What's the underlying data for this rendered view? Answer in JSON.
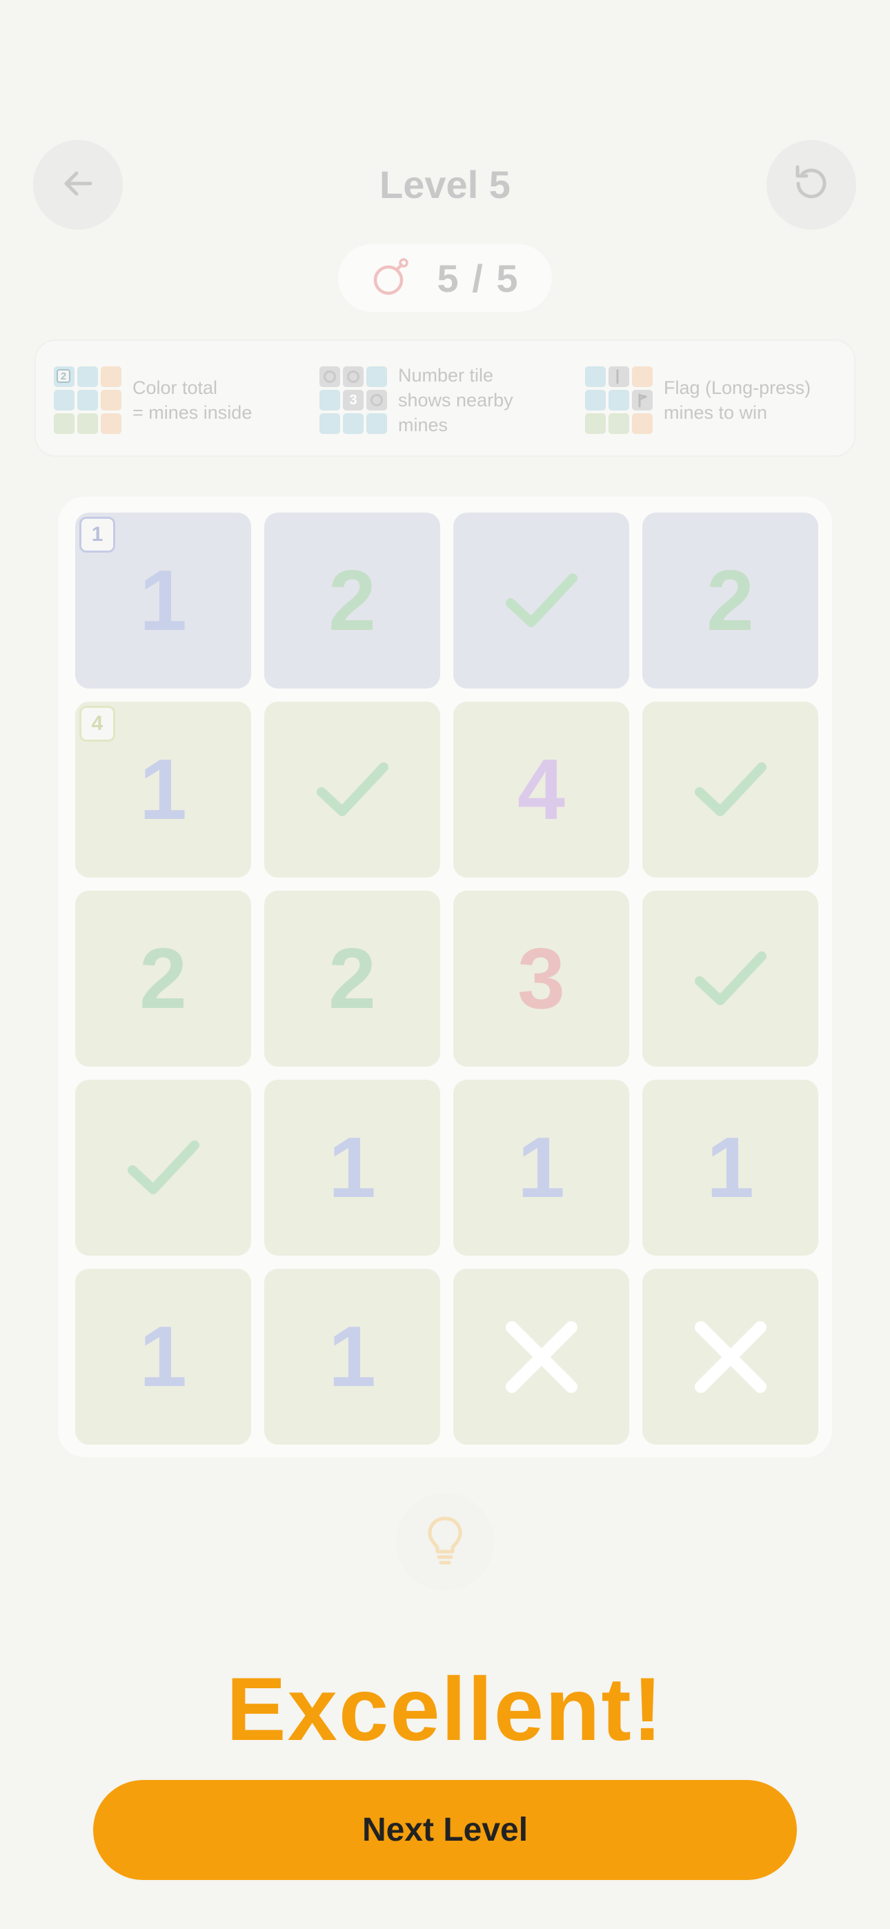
{
  "header": {
    "title": "Level 5",
    "back_icon": "arrow-left-icon",
    "restart_icon": "restart-icon"
  },
  "mines": {
    "icon": "bomb-icon",
    "count": "5 / 5"
  },
  "legend": {
    "items": [
      {
        "text_line1": "Color total",
        "text_line2": "= mines inside",
        "badge_num": "2"
      },
      {
        "text_line1": "Number tile",
        "text_line2": "shows nearby",
        "text_line3": "mines",
        "center_num": "3"
      },
      {
        "text_line1": "Flag (Long-press)",
        "text_line2": "mines to win"
      }
    ]
  },
  "board": {
    "rows": [
      [
        {
          "region": "blue",
          "badge": "1",
          "type": "number",
          "value": "1",
          "color": "blue"
        },
        {
          "region": "blue",
          "type": "number",
          "value": "2",
          "color": "green"
        },
        {
          "region": "blue",
          "type": "check"
        },
        {
          "region": "blue",
          "type": "number",
          "value": "2",
          "color": "green"
        }
      ],
      [
        {
          "region": "green",
          "badge": "4",
          "type": "number",
          "value": "1",
          "color": "blue"
        },
        {
          "region": "green",
          "type": "check"
        },
        {
          "region": "green",
          "type": "number",
          "value": "4",
          "color": "purple"
        },
        {
          "region": "green",
          "type": "check"
        }
      ],
      [
        {
          "region": "green",
          "type": "number",
          "value": "2",
          "color": "green"
        },
        {
          "region": "green",
          "type": "number",
          "value": "2",
          "color": "green"
        },
        {
          "region": "green",
          "type": "number",
          "value": "3",
          "color": "red"
        },
        {
          "region": "green",
          "type": "check"
        }
      ],
      [
        {
          "region": "green",
          "type": "check"
        },
        {
          "region": "green",
          "type": "number",
          "value": "1",
          "color": "blue"
        },
        {
          "region": "green",
          "type": "number",
          "value": "1",
          "color": "blue"
        },
        {
          "region": "green",
          "type": "number",
          "value": "1",
          "color": "blue"
        }
      ],
      [
        {
          "region": "green",
          "type": "number",
          "value": "1",
          "color": "blue"
        },
        {
          "region": "green",
          "type": "number",
          "value": "1",
          "color": "blue"
        },
        {
          "region": "green",
          "type": "cross"
        },
        {
          "region": "green",
          "type": "cross"
        }
      ]
    ]
  },
  "hint": {
    "icon": "lightbulb-icon"
  },
  "result": {
    "message": "Excellent!",
    "next_label": "Next Level"
  },
  "colors": {
    "accent": "#f59f0c",
    "background": "#f5f5f1",
    "region_blue": "#e3e5ec",
    "region_green": "#eceee0",
    "check": "#c4e2c8",
    "cross": "#ffffff"
  }
}
